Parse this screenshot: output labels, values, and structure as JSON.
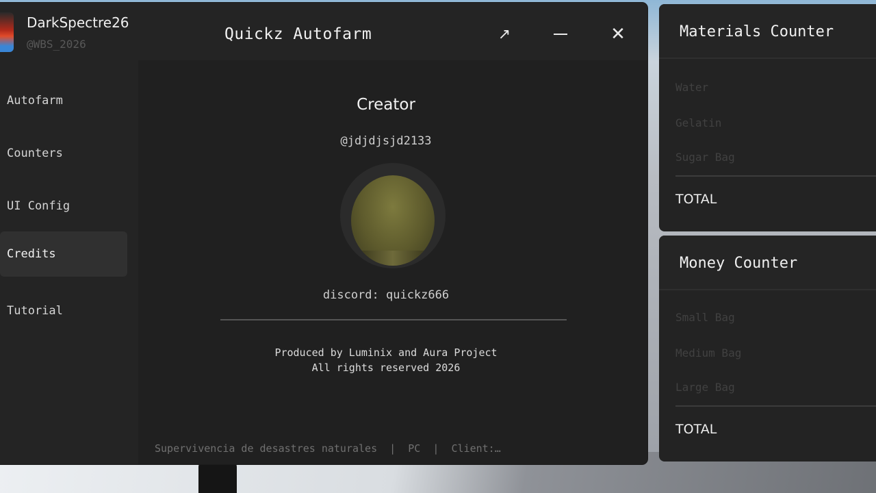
{
  "window": {
    "title": "Quickz Autofarm",
    "user": {
      "name": "DarkSpectre26",
      "handle": "@WBS_2026"
    },
    "controls": {
      "expand_icon": "↗",
      "close_icon": "✕"
    }
  },
  "sidebar": {
    "items": [
      {
        "label": "Autofarm",
        "active": false
      },
      {
        "label": "Counters",
        "active": false
      },
      {
        "label": "UI Config",
        "active": false
      },
      {
        "label": "Credits",
        "active": true
      },
      {
        "label": "Tutorial",
        "active": false
      }
    ]
  },
  "credits": {
    "heading": "Creator",
    "creator_handle": "@jdjdjsjd2133",
    "discord": "discord: quickz666",
    "produced_by": "Produced by Luminix and Aura Project",
    "rights": "All rights reserved 2026",
    "footer": "Supervivencia de desastres naturales  |  PC  |  Client:…"
  },
  "materials_counter": {
    "title": "Materials Counter",
    "rows": [
      "Water",
      "Gelatin",
      "Sugar Bag"
    ],
    "total_label": "TOTAL"
  },
  "money_counter": {
    "title": "Money Counter",
    "rows": [
      "Small Bag",
      "Medium Bag",
      "Large Bag"
    ],
    "total_label": "TOTAL"
  }
}
